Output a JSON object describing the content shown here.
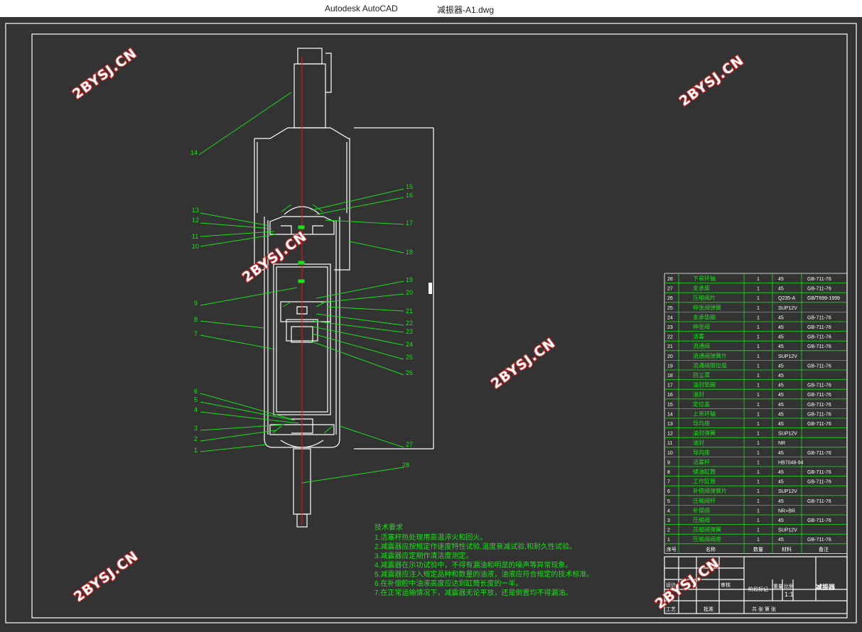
{
  "window": {
    "app_title": "Autodesk AutoCAD",
    "doc_title": "减振器-A1.dwg"
  },
  "watermark": {
    "text": "2BYSJ.CN",
    "color": "#d22222"
  },
  "colors": {
    "canvas": "#333333",
    "linework": "#19e019",
    "geometry": "#ffffff",
    "centerline": "#e01818"
  },
  "drawing": {
    "left_callouts": [
      "14",
      "13",
      "12",
      "11",
      "10",
      "9",
      "8",
      "7",
      "6",
      "5",
      "4",
      "3",
      "2",
      "1"
    ],
    "right_callouts": [
      "15",
      "16",
      "17",
      "18",
      "19",
      "20",
      "21",
      "22",
      "23",
      "24",
      "25",
      "26",
      "27",
      "28"
    ]
  },
  "tech": {
    "title": "技术要求",
    "lines": [
      "1.活塞杆热处理用高温淬火和回火。",
      "2.减震器应按规定作速度特性试验,温度衰减试验,和耐久性试验。",
      "3.减震器应定期作清洁度测定。",
      "4.减震器在示功试验中，不得有漏油和明显的噪声等异常现象。",
      "5.减震器应注入规定品种和数量的油液，油液应符合规定的技术标准。",
      "6.在补偿腔中油液高度应达到缸筒长度的一半。",
      "7.在正常运输情况下，减震器无论平放，还是倒置均不得漏油。"
    ]
  },
  "bom": {
    "rows": [
      {
        "no": "28",
        "name": "下吊环轴",
        "qty": "1",
        "mat": "45",
        "std": "GB-711-76"
      },
      {
        "no": "27",
        "name": "支承座",
        "qty": "1",
        "mat": "45",
        "std": "GB-711-76"
      },
      {
        "no": "26",
        "name": "压缩阀片",
        "qty": "1",
        "mat": "Q235-A",
        "std": "GB/T699-1999"
      },
      {
        "no": "25",
        "name": "伸张阀弹簧",
        "qty": "1",
        "mat": "SUP12V",
        "std": ""
      },
      {
        "no": "24",
        "name": "支承垫圈",
        "qty": "1",
        "mat": "45",
        "std": "GB-711-76"
      },
      {
        "no": "23",
        "name": "伸张阀",
        "qty": "1",
        "mat": "45",
        "std": "GB-711-76"
      },
      {
        "no": "22",
        "name": "活塞",
        "qty": "1",
        "mat": "45",
        "std": "GB-711-76"
      },
      {
        "no": "21",
        "name": "流通阀",
        "qty": "1",
        "mat": "45",
        "std": "GB-711-76"
      },
      {
        "no": "20",
        "name": "流通阀弹簧片",
        "qty": "1",
        "mat": "SUP12V",
        "std": ""
      },
      {
        "no": "19",
        "name": "流通阀限位座",
        "qty": "1",
        "mat": "45",
        "std": "GB-711-76"
      },
      {
        "no": "18",
        "name": "防尘罩",
        "qty": "1",
        "mat": "45",
        "std": ""
      },
      {
        "no": "17",
        "name": "油封垫圈",
        "qty": "1",
        "mat": "45",
        "std": "GB-711-76"
      },
      {
        "no": "16",
        "name": "油封",
        "qty": "1",
        "mat": "45",
        "std": "GB-711-76"
      },
      {
        "no": "15",
        "name": "定位盖",
        "qty": "1",
        "mat": "45",
        "std": "GB-711-76"
      },
      {
        "no": "14",
        "name": "上吊环轴",
        "qty": "1",
        "mat": "45",
        "std": "GB-711-76"
      },
      {
        "no": "13",
        "name": "导向座",
        "qty": "1",
        "mat": "45",
        "std": "GB-711-76"
      },
      {
        "no": "12",
        "name": "油封弹簧",
        "qty": "1",
        "mat": "SUP12V",
        "std": ""
      },
      {
        "no": "11",
        "name": "油封",
        "qty": "1",
        "mat": "NR",
        "std": ""
      },
      {
        "no": "10",
        "name": "导向座",
        "qty": "1",
        "mat": "45",
        "std": "GB-711-76"
      },
      {
        "no": "9",
        "name": "活塞杆",
        "qty": "1",
        "mat": "HB7048-94",
        "std": ""
      },
      {
        "no": "8",
        "name": "储油缸筒",
        "qty": "1",
        "mat": "45",
        "std": "GB-711-76"
      },
      {
        "no": "7",
        "name": "工作缸筒",
        "qty": "1",
        "mat": "45",
        "std": "GB-711-76"
      },
      {
        "no": "6",
        "name": "补偿阀弹簧片",
        "qty": "1",
        "mat": "SUP12V",
        "std": ""
      },
      {
        "no": "5",
        "name": "压缩阀杆",
        "qty": "1",
        "mat": "45",
        "std": "GB-711-76"
      },
      {
        "no": "4",
        "name": "补偿阀",
        "qty": "1",
        "mat": "NR+BR",
        "std": ""
      },
      {
        "no": "3",
        "name": "压缩阀",
        "qty": "1",
        "mat": "45",
        "std": "GB-711-76"
      },
      {
        "no": "2",
        "name": "压缩阀弹簧",
        "qty": "1",
        "mat": "SUP12V",
        "std": ""
      },
      {
        "no": "1",
        "name": "压缩阀阀座",
        "qty": "1",
        "mat": "45",
        "std": "GB-711-76"
      }
    ],
    "header": {
      "no": "序号",
      "name": "名称",
      "qty": "数量",
      "mat": "材料",
      "std": "备注"
    }
  },
  "titleblock": {
    "drawing_name": "减振器",
    "scale_label": "比例",
    "scale": "1:1",
    "designer_label": "设计",
    "check_label": "审核",
    "stage_label": "阶段标记",
    "weight_label": "重量",
    "approve_label": "批准",
    "craft_label": "工艺",
    "sheet_label": "共  张 第  张"
  }
}
